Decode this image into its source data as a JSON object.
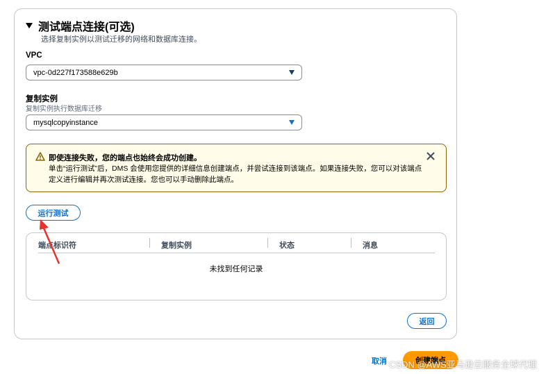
{
  "section": {
    "title": "测试端点连接(可选)",
    "description": "选择复制实例以测试迁移的网络和数据库连接。"
  },
  "vpc": {
    "label": "VPC",
    "value": "vpc-0d227f173588e629b"
  },
  "replication": {
    "label": "复制实例",
    "sublabel": "复制实例执行数据库迁移",
    "value": "mysqlcopyinstance"
  },
  "alert": {
    "title": "即使连接失败，您的端点也始终会成功创建。",
    "body": "单击“运行测试”后，DMS 会使用您提供的详细信息创建端点，并尝试连接到该端点。如果连接失败，您可以对该端点定义进行编辑并再次测试连接。您也可以手动删除此端点。",
    "icon": "warning-icon",
    "color": "#8d6605"
  },
  "buttons": {
    "run_test": "运行测试",
    "back": "返回",
    "cancel": "取消",
    "create": "创建端点"
  },
  "table": {
    "columns": [
      "端点标识符",
      "复制实例",
      "状态",
      "消息"
    ],
    "empty": "未找到任何记录"
  },
  "watermark": "CSDN @AWS亚马逊云服务全球代理",
  "colors": {
    "accent": "#0972d3",
    "primary_button": "#ff9900",
    "annotation_arrow": "#e8322b"
  }
}
